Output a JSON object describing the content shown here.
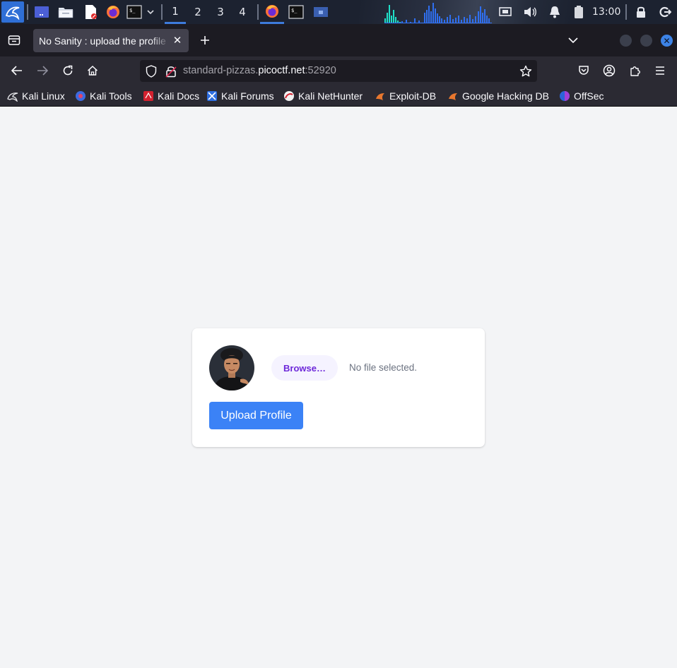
{
  "taskbar": {
    "workspaces": [
      "1",
      "2",
      "3",
      "4"
    ],
    "active_workspace": "1",
    "clock": "13:00"
  },
  "browser": {
    "tab_title": "No Sanity : upload the profile",
    "url_prefix": "standard-pizzas.",
    "url_host": "picoctf.net",
    "url_suffix": ":52920",
    "bookmarks": [
      "Kali Linux",
      "Kali Tools",
      "Kali Docs",
      "Kali Forums",
      "Kali NetHunter",
      "Exploit-DB",
      "Google Hacking DB",
      "OffSec"
    ]
  },
  "page": {
    "browse_label": "Browse…",
    "file_status": "No file selected.",
    "upload_label": "Upload Profile"
  },
  "colors": {
    "accent": "#3b82f6",
    "browse_bg": "#f5f3ff",
    "browse_text": "#6d28d9",
    "page_bg": "#f3f4f6"
  }
}
